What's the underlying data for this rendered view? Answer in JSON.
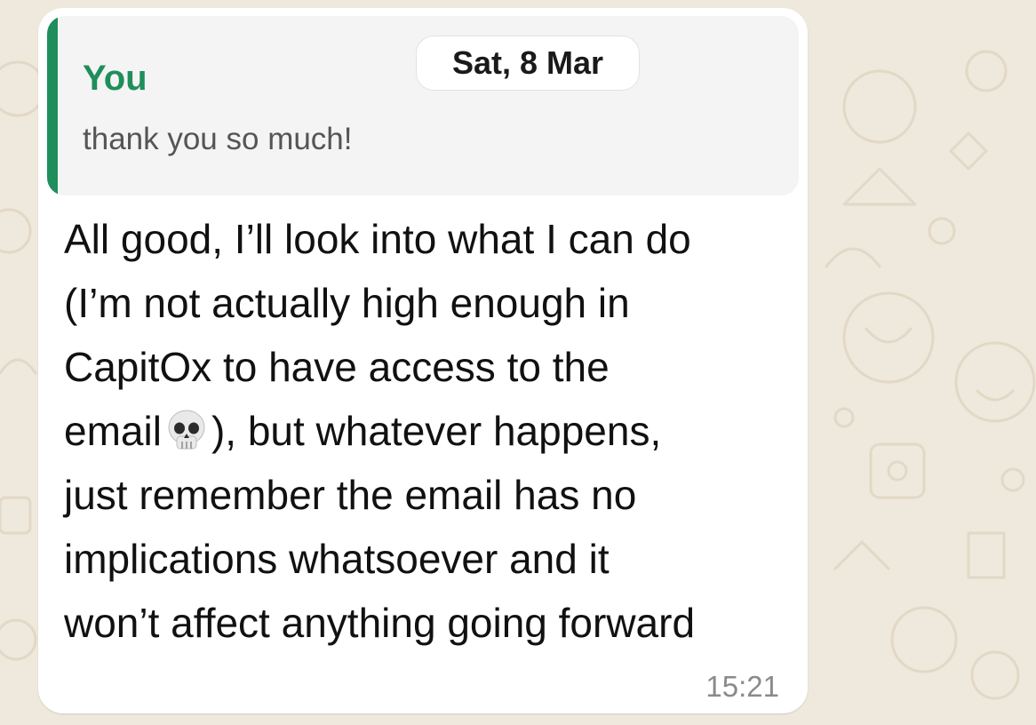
{
  "chat": {
    "date_separator": "Sat, 8 Mar",
    "reply_quote": {
      "author": "You",
      "text": "thank you so much!",
      "accent_color": "#1f8e5c"
    },
    "message": {
      "lines": [
        "All good, I’ll look into what I can do",
        "(I’m not actually high enough in",
        "CapitOx to have access to the",
        "email",
        "), but whatever happens,",
        "just remember the email has no",
        "implications whatsoever and it",
        "won’t affect anything going forward"
      ],
      "emoji": "skull-emoji",
      "time": "15:21"
    }
  },
  "theme": {
    "wallpaper_color": "#efe8dc",
    "bubble_color": "#ffffff",
    "quote_background": "#f4f4f4"
  }
}
